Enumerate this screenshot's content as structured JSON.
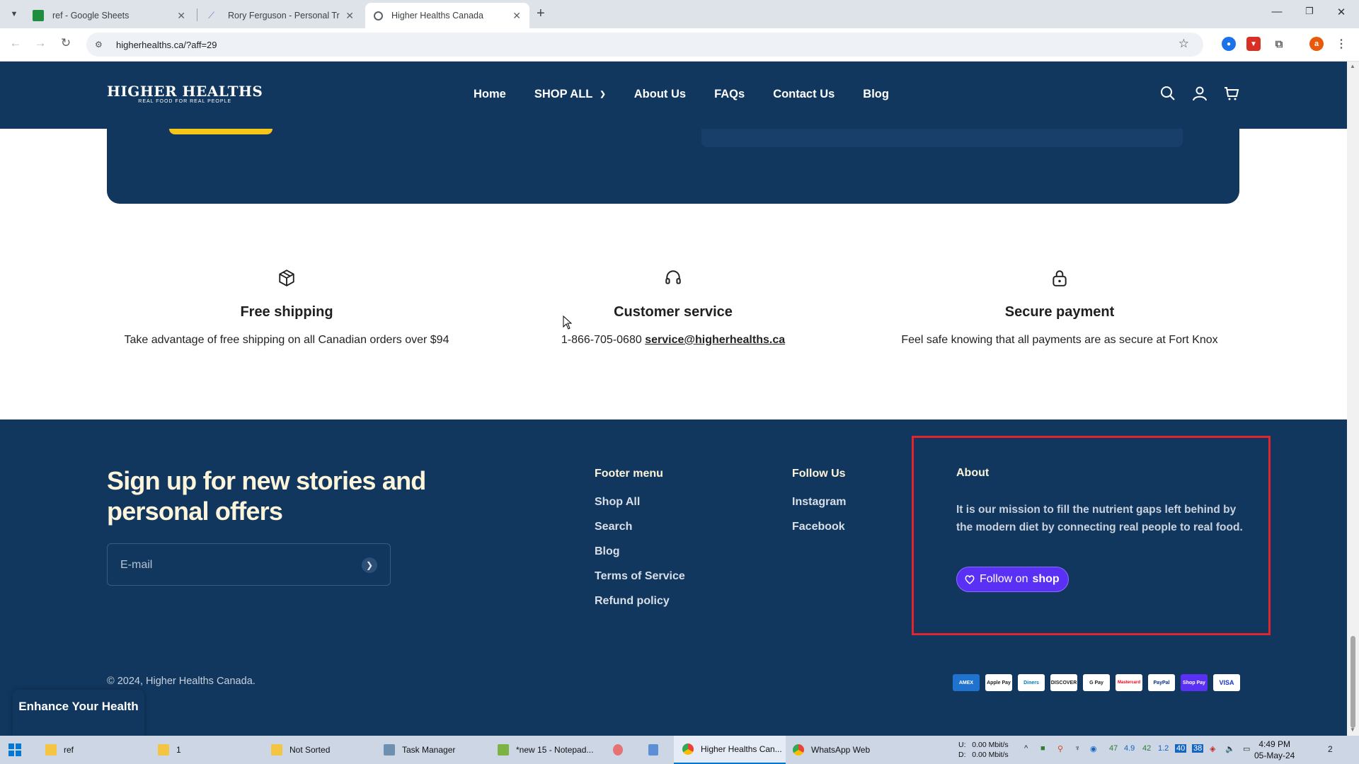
{
  "browser": {
    "tabs": [
      {
        "title": "ref - Google Sheets",
        "favicon_color": "#1e8e3e"
      },
      {
        "title": "Rory Ferguson - Personal Traini",
        "favicon_color": "#6b7cb8"
      },
      {
        "title": "Higher Healths Canada",
        "favicon_color": "#5f6368"
      }
    ],
    "url": "higherhealths.ca/?aff=29",
    "profile_initial": "a"
  },
  "header": {
    "logo_main": "HIGHER HEALTHS",
    "logo_tagline": "REAL FOOD FOR REAL PEOPLE",
    "nav": [
      "Home",
      "SHOP ALL",
      "About Us",
      "FAQs",
      "Contact Us",
      "Blog"
    ]
  },
  "features": [
    {
      "icon": "box-icon",
      "title": "Free shipping",
      "text": "Take advantage of free shipping on all Canadian orders over $94"
    },
    {
      "icon": "headset-icon",
      "title": "Customer service",
      "phone": "1-866-705-0680",
      "email": "service@higherhealths.ca"
    },
    {
      "icon": "lock-icon",
      "title": "Secure payment",
      "text": "Feel safe knowing that all payments are as secure at Fort Knox"
    }
  ],
  "footer": {
    "signup_title": "Sign up for new stories and personal offers",
    "email_placeholder": "E-mail",
    "menu_title": "Footer menu",
    "menu_links": [
      "Shop All",
      "Search",
      "Blog",
      "Terms of Service",
      "Refund policy"
    ],
    "follow_title": "Follow Us",
    "follow_links": [
      "Instagram",
      "Facebook"
    ],
    "about_title": "About",
    "about_text": "It is our mission to fill the nutrient gaps left behind by the modern diet by connecting real people to real food.",
    "shop_button_prefix": "Follow on",
    "shop_button_brand": "shop",
    "copyright": "© 2024, Higher Healths Canada.",
    "payments": [
      "AMEX",
      "Apple Pay",
      "Diners",
      "DISCOVER",
      "G Pay",
      "Mastercard",
      "PayPal",
      "Shop Pay",
      "VISA"
    ],
    "highlight_color": "#e0252f"
  },
  "enhance_widget": "Enhance Your Health",
  "taskbar": {
    "items": [
      "ref",
      "1",
      "Not Sorted",
      "Task Manager",
      "*new 15 - Notepad...",
      "Higher Healths Can...",
      "WhatsApp Web"
    ],
    "net_up": "U:",
    "net_up_val": "0.00 Mbit/s",
    "net_down": "D:",
    "net_down_val": "0.00 Mbit/s",
    "tray_numbers": [
      "47",
      "4.9",
      "42",
      "1.2"
    ],
    "tray_badges": [
      "40",
      "38"
    ],
    "time": "4:49 PM",
    "date": "05-May-24",
    "notification_count": "2"
  },
  "colors": {
    "brand_navy": "#11375f",
    "accent_yellow": "#f5c518",
    "cream": "#fdf5da",
    "shop_purple": "#5a31f4"
  }
}
